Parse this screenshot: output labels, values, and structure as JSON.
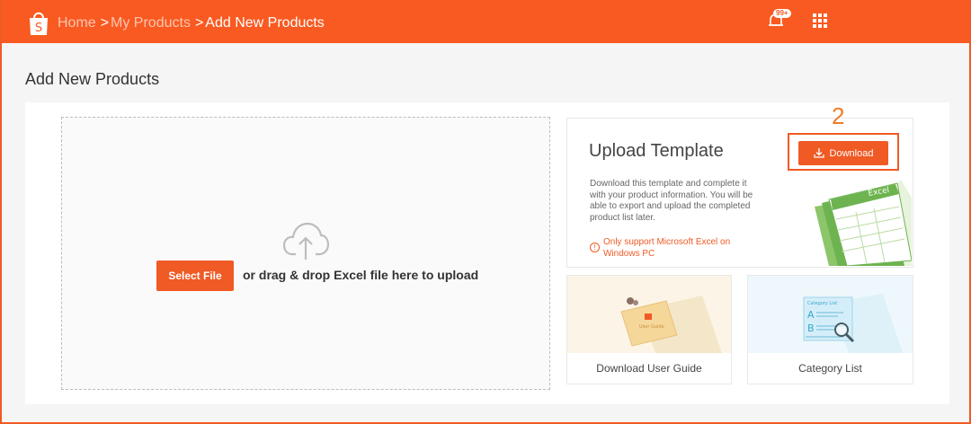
{
  "header": {
    "breadcrumb": [
      "Home",
      "My Products",
      "Add New Products"
    ],
    "separator": ">",
    "notification_badge": "99+"
  },
  "page": {
    "title": "Add New Products"
  },
  "upload_area": {
    "select_file_label": "Select File",
    "drop_text": "or drag & drop Excel file here to upload"
  },
  "template_panel": {
    "title": "Upload Template",
    "download_label": "Download",
    "description": "Download this template and complete it with your product information. You will be able to export and upload the completed product list later.",
    "warning": "Only support Microsoft Excel on Windows PC",
    "art_label": "Excel",
    "step_number": "2"
  },
  "cards": {
    "user_guide": {
      "label": "Download User Guide",
      "art_label": "User Guide"
    },
    "category_list": {
      "label": "Category List",
      "art_label": "Category List"
    }
  },
  "colors": {
    "brand": "#f05a24",
    "topbar": "#f95a21",
    "step": "#f07b2a"
  }
}
